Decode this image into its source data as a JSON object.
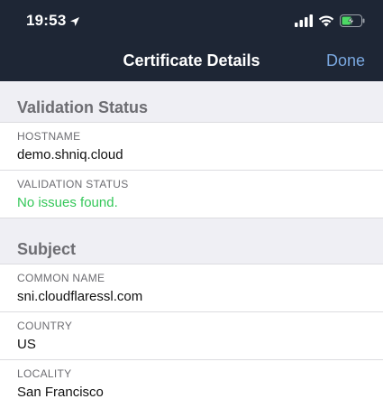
{
  "status_bar": {
    "time": "19:53",
    "location_icon": "location-arrow-icon",
    "signal_icon": "cellular-signal-icon",
    "wifi_icon": "wifi-icon",
    "battery_icon": "battery-charging-icon",
    "battery_color": "#4cd964"
  },
  "nav": {
    "title": "Certificate Details",
    "done_label": "Done",
    "accent_color": "#7aa8e0",
    "background_color": "#1e2635"
  },
  "sections": [
    {
      "title": "Validation Status",
      "rows": [
        {
          "label": "HOSTNAME",
          "value": "demo.shniq.cloud"
        },
        {
          "label": "VALIDATION STATUS",
          "value": "No issues found.",
          "status_color": "#34c759"
        }
      ]
    },
    {
      "title": "Subject",
      "rows": [
        {
          "label": "COMMON NAME",
          "value": "sni.cloudflaressl.com"
        },
        {
          "label": "COUNTRY",
          "value": "US"
        },
        {
          "label": "LOCALITY",
          "value": "San Francisco"
        }
      ]
    }
  ]
}
